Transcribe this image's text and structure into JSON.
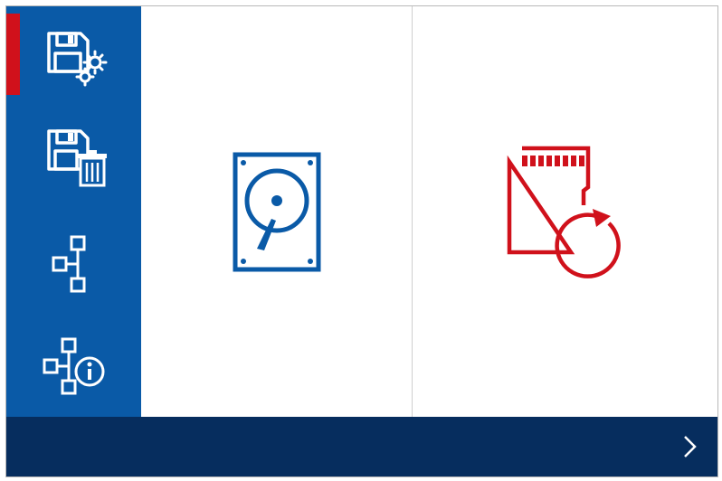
{
  "colors": {
    "sidebar_bg": "#0a5aa7",
    "active_marker": "#d0111b",
    "bottom_bar": "#062d5e",
    "content_bg": "#ffffff",
    "left_icon": "#0a5aa7",
    "right_icon": "#d0111b"
  },
  "sidebar": {
    "items": [
      {
        "icon": "save-settings-icon",
        "active": true
      },
      {
        "icon": "save-delete-icon",
        "active": false
      },
      {
        "icon": "network-icon",
        "active": false
      },
      {
        "icon": "network-info-icon",
        "active": false
      }
    ]
  },
  "panels": [
    {
      "icon": "hard-drive-icon"
    },
    {
      "icon": "sd-card-restore-icon"
    }
  ],
  "footer": {
    "next_icon": "chevron-right-icon"
  }
}
